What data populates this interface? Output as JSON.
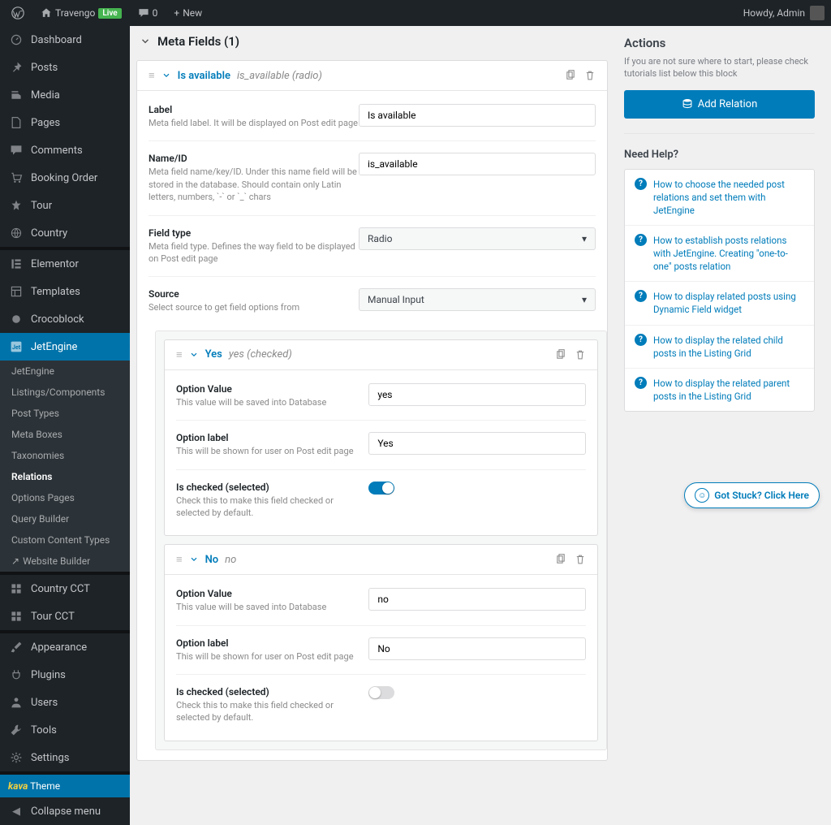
{
  "topbar": {
    "site_name": "Travengo",
    "live": "Live",
    "comments_count": "0",
    "new": "New",
    "howdy": "Howdy, Admin"
  },
  "sidebar": {
    "items": [
      {
        "icon": "dashboard",
        "label": "Dashboard"
      },
      {
        "icon": "pin",
        "label": "Posts"
      },
      {
        "icon": "media",
        "label": "Media"
      },
      {
        "icon": "page",
        "label": "Pages"
      },
      {
        "icon": "comment",
        "label": "Comments"
      },
      {
        "icon": "cart",
        "label": "Booking Order"
      },
      {
        "icon": "tour",
        "label": "Tour"
      },
      {
        "icon": "globe",
        "label": "Country"
      }
    ],
    "items2": [
      {
        "icon": "elementor",
        "label": "Elementor"
      },
      {
        "icon": "templates",
        "label": "Templates"
      },
      {
        "icon": "croco",
        "label": "Crocoblock"
      }
    ],
    "jetengine": "JetEngine",
    "sub": [
      "JetEngine",
      "Listings/Components",
      "Post Types",
      "Meta Boxes",
      "Taxonomies",
      "Relations",
      "Options Pages",
      "Query Builder",
      "Custom Content Types",
      "Website Builder"
    ],
    "sub_active_index": 5,
    "items3": [
      {
        "icon": "grid",
        "label": "Country CCT"
      },
      {
        "icon": "grid",
        "label": "Tour CCT"
      }
    ],
    "items4": [
      {
        "icon": "brush",
        "label": "Appearance"
      },
      {
        "icon": "plug",
        "label": "Plugins"
      },
      {
        "icon": "user",
        "label": "Users"
      },
      {
        "icon": "wrench",
        "label": "Tools"
      },
      {
        "icon": "gear",
        "label": "Settings"
      }
    ],
    "theme_brand": "kava",
    "theme": "Theme",
    "collapse": "Collapse menu"
  },
  "header": {
    "title": "Meta Fields (1)"
  },
  "meta_field": {
    "title": "Is available",
    "slug": "is_available (radio)",
    "label": {
      "lab": "Label",
      "desc": "Meta field label. It will be displayed on Post edit page",
      "value": "Is available"
    },
    "name": {
      "lab": "Name/ID",
      "desc": "Meta field name/key/ID. Under this name field will be stored in the database. Should contain only Latin letters, numbers, `-` or `_` chars",
      "value": "is_available"
    },
    "type": {
      "lab": "Field type",
      "desc": "Meta field type. Defines the way field to be displayed on Post edit page",
      "value": "Radio"
    },
    "source": {
      "lab": "Source",
      "desc": "Select source to get field options from",
      "value": "Manual Input"
    }
  },
  "options": [
    {
      "title": "Yes",
      "slug": "yes (checked)",
      "value": {
        "lab": "Option Value",
        "desc": "This value will be saved into Database",
        "val": "yes"
      },
      "label": {
        "lab": "Option label",
        "desc": "This will be shown for user on Post edit page",
        "val": "Yes"
      },
      "checked": {
        "lab": "Is checked (selected)",
        "desc": "Check this to make this field checked or selected by default.",
        "on": true
      }
    },
    {
      "title": "No",
      "slug": "no",
      "value": {
        "lab": "Option Value",
        "desc": "This value will be saved into Database",
        "val": "no"
      },
      "label": {
        "lab": "Option label",
        "desc": "This will be shown for user on Post edit page",
        "val": "No"
      },
      "checked": {
        "lab": "Is checked (selected)",
        "desc": "Check this to make this field checked or selected by default.",
        "on": false
      }
    }
  ],
  "right": {
    "actions_title": "Actions",
    "actions_desc": "If you are not sure where to start, please check tutorials list below this block",
    "add_btn": "Add Relation",
    "help_title": "Need Help?",
    "help": [
      "How to choose the needed post relations and set them with JetEngine",
      "How to establish posts relations with JetEngine. Creating \"one-to-one\" posts relation",
      "How to display related posts using Dynamic Field widget",
      "How to display the related child posts in the Listing Grid",
      "How to display the related parent posts in the Listing Grid"
    ]
  },
  "stuck": "Got Stuck? Click Here"
}
